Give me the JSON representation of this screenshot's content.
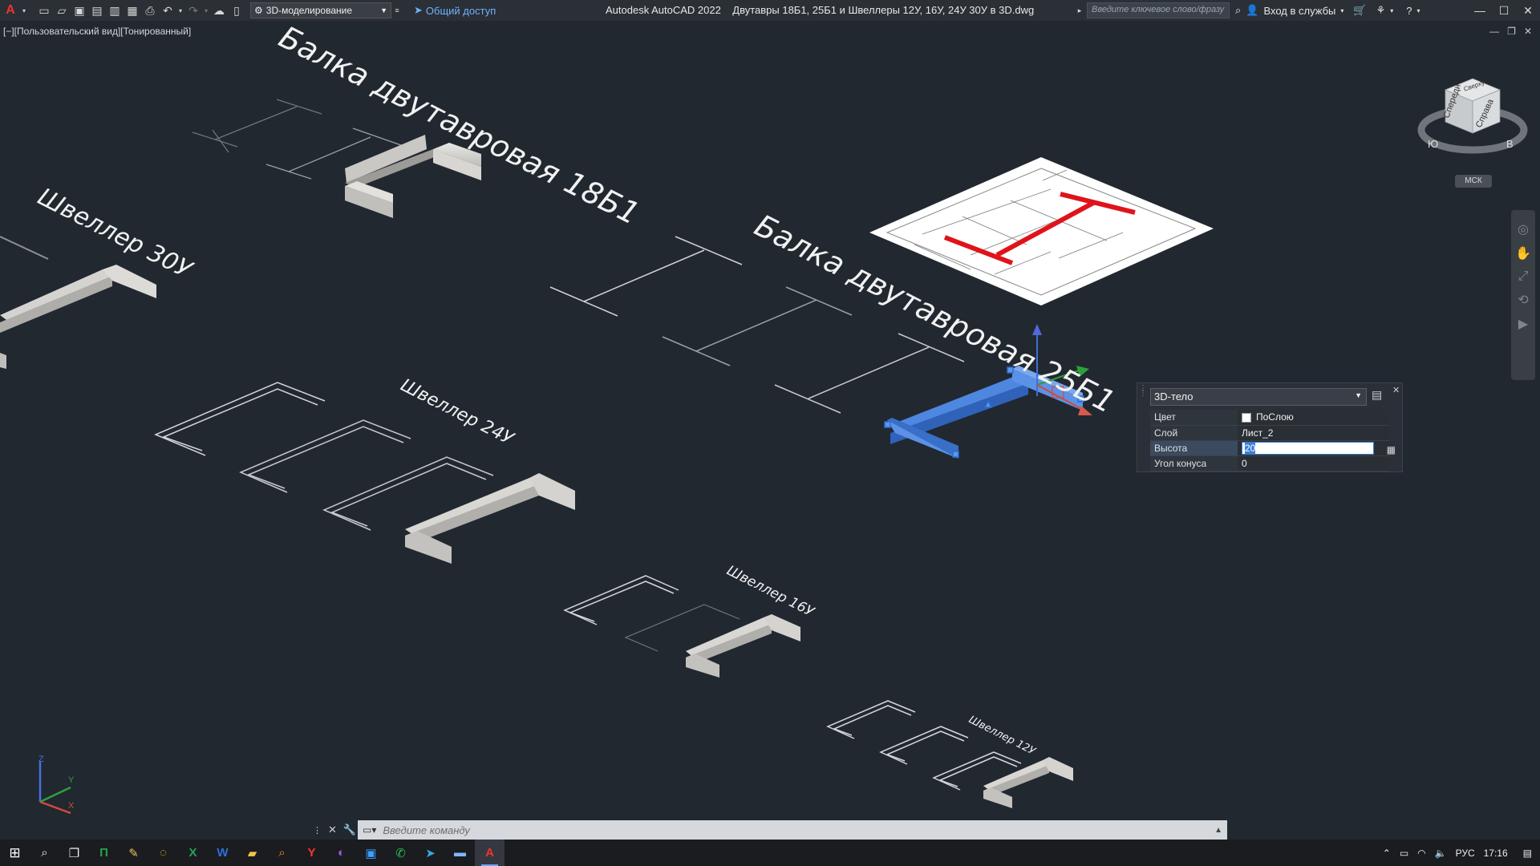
{
  "titlebar": {
    "app_icon": "autocad-logo-icon",
    "workspace": "3D-моделирование",
    "share_label": "Общий доступ",
    "app_title": "Autodesk AutoCAD 2022",
    "file_title": "Двутавры 18Б1, 25Б1 и Швеллеры 12У, 16У, 24У 30У в 3D.dwg",
    "search_placeholder": "Введите ключевое слово/фразу",
    "signin_label": "Вход в службы"
  },
  "viewport": {
    "view_label": "[−][Пользовательский вид][Тонированный]",
    "labels": {
      "beam_18": "Балка двутавровая 18Б1",
      "beam_25": "Балка двутавровая 25Б1",
      "channel_30": "Швеллер 30У",
      "channel_24": "Швеллер 24У",
      "channel_16": "Швеллер 16У",
      "channel_12": "Швеллер 12У"
    },
    "viewcube": {
      "top": "Сверху",
      "front": "Спереди",
      "right": "Справа",
      "south": "Ю",
      "east": "В"
    },
    "wcs_label": "МСК",
    "ucs": {
      "x": "X",
      "y": "Y",
      "z": "Z"
    }
  },
  "properties": {
    "object_type": "3D-тело",
    "rows": [
      {
        "key": "Цвет",
        "value": "ПоСлою"
      },
      {
        "key": "Слой",
        "value": "Лист_2"
      },
      {
        "key": "Высота",
        "value": "20"
      },
      {
        "key": "Угол конуса",
        "value": "0"
      }
    ]
  },
  "command": {
    "placeholder": "Введите команду"
  },
  "taskbar": {
    "lang": "РУС",
    "time": "17:16"
  },
  "colors": {
    "background": "#212830",
    "selection_blue": "#3d7bd8",
    "accent_red": "#e0131a"
  }
}
